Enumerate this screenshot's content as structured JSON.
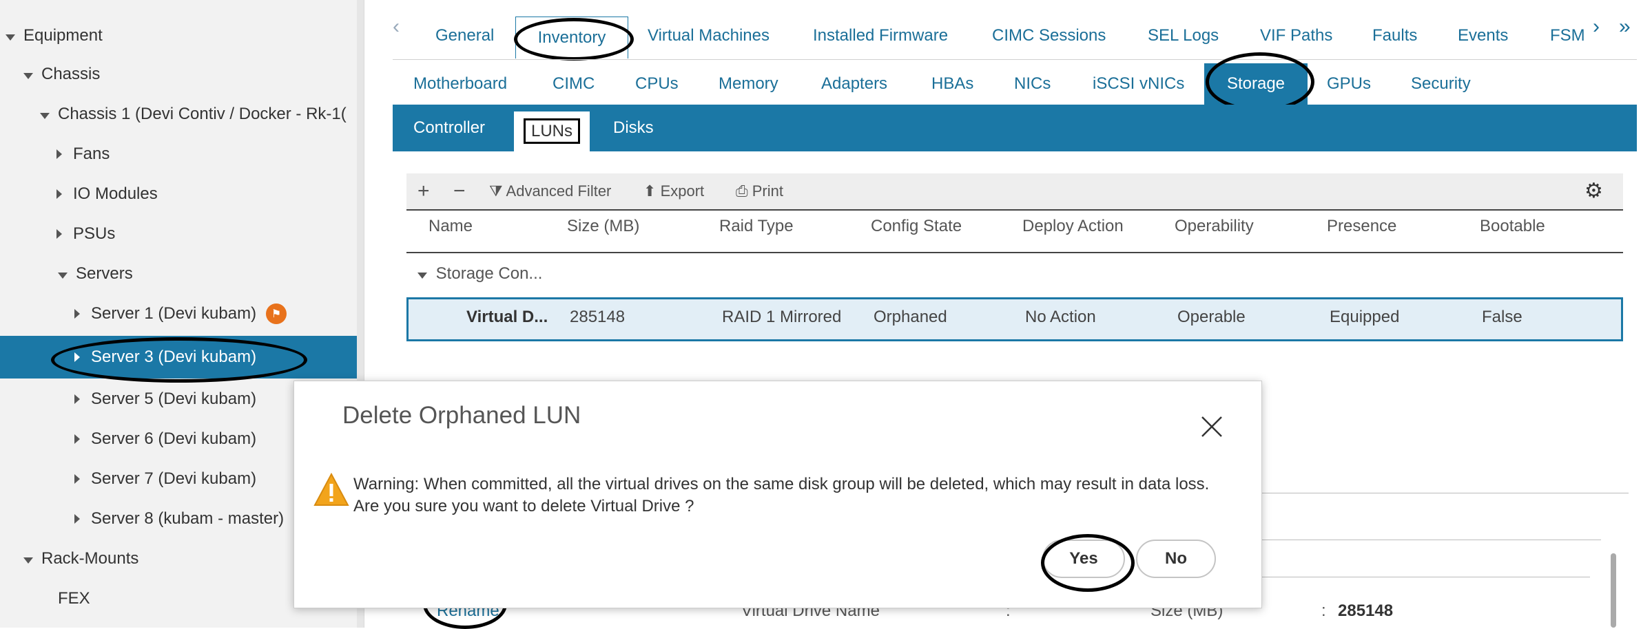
{
  "tree": {
    "items": [
      {
        "label": "Equipment"
      },
      {
        "label": "Chassis"
      },
      {
        "label": "Chassis 1 (Devi Contiv / Docker - Rk-1("
      },
      {
        "label": "Fans"
      },
      {
        "label": "IO Modules"
      },
      {
        "label": "PSUs"
      },
      {
        "label": "Servers"
      },
      {
        "label": "Server 1 (Devi kubam)",
        "badge": "shield-icon"
      },
      {
        "label": "Server 3 (Devi kubam)",
        "selected": true
      },
      {
        "label": "Server 5 (Devi kubam)"
      },
      {
        "label": "Server 6 (Devi kubam)"
      },
      {
        "label": "Server 7 (Devi kubam)"
      },
      {
        "label": "Server 8 (kubam - master)"
      },
      {
        "label": "Rack-Mounts"
      },
      {
        "label": "FEX"
      }
    ]
  },
  "main_tabs": [
    "General",
    "Inventory",
    "Virtual Machines",
    "Installed Firmware",
    "CIMC Sessions",
    "SEL Logs",
    "VIF Paths",
    "Faults",
    "Events",
    "FSM"
  ],
  "main_tabs_active": "Inventory",
  "inventory_tabs": [
    "Motherboard",
    "CIMC",
    "CPUs",
    "Memory",
    "Adapters",
    "HBAs",
    "NICs",
    "iSCSI vNICs",
    "Storage",
    "GPUs",
    "Security"
  ],
  "inventory_tabs_active": "Storage",
  "storage_tabs": [
    "Controller",
    "LUNs",
    "Disks"
  ],
  "storage_tabs_active": "LUNs",
  "toolbar": {
    "add": "+",
    "remove": "−",
    "filter": "Advanced Filter",
    "export": "Export",
    "print": "Print"
  },
  "table": {
    "columns": [
      "Name",
      "Size (MB)",
      "Raid Type",
      "Config State",
      "Deploy Action",
      "Operability",
      "Presence",
      "Bootable"
    ],
    "group": "Storage Con...",
    "rows": [
      [
        "Virtual D...",
        "285148",
        "RAID 1 Mirrored",
        "Orphaned",
        "No Action",
        "Operable",
        "Equipped",
        "False"
      ]
    ]
  },
  "details": {
    "rename_link": "Rename",
    "virtual_drive_name_label": "Virtual Drive Name",
    "colon": ":",
    "size_label": "Size (MB)",
    "size_value": "285148"
  },
  "modal": {
    "title": "Delete Orphaned LUN",
    "warning_line1": "Warning: When committed, all the virtual drives on the same disk group will be deleted, which may result in data loss.",
    "warning_line2": "Are you sure you want to delete Virtual Drive ?",
    "yes": "Yes",
    "no": "No"
  },
  "colors": {
    "accent": "#1b78a6",
    "link": "#1b6f98",
    "warning": "#f2a41c",
    "badge": "#e8721c"
  }
}
